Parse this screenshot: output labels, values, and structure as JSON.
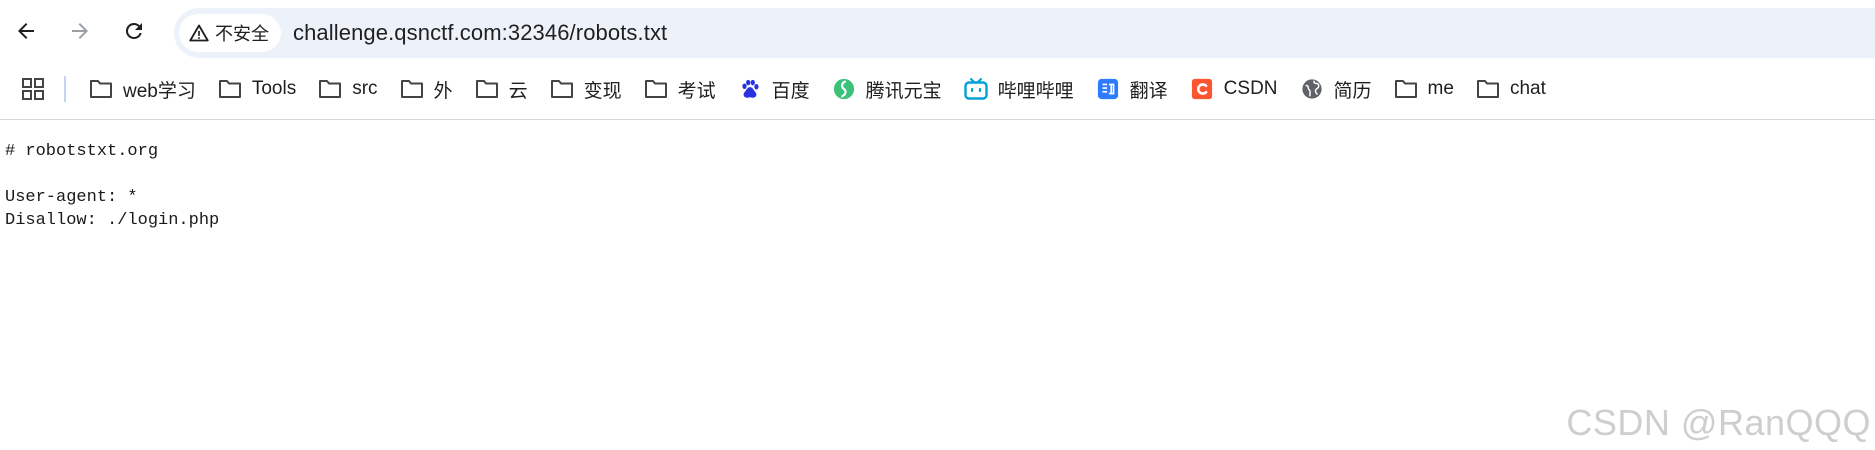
{
  "toolbar": {
    "security_label": "不安全",
    "url": "challenge.qsnctf.com:32346/robots.txt"
  },
  "bookmarks": [
    {
      "label": "web学习",
      "icon": "folder-icon"
    },
    {
      "label": "Tools",
      "icon": "folder-icon"
    },
    {
      "label": "src",
      "icon": "folder-icon"
    },
    {
      "label": "外",
      "icon": "folder-icon"
    },
    {
      "label": "云",
      "icon": "folder-icon"
    },
    {
      "label": "变现",
      "icon": "folder-icon"
    },
    {
      "label": "考试",
      "icon": "folder-icon"
    },
    {
      "label": "百度",
      "icon": "baidu-paw-icon"
    },
    {
      "label": "腾讯元宝",
      "icon": "yuanbao-icon"
    },
    {
      "label": "哔哩哔哩",
      "icon": "bilibili-tv-icon"
    },
    {
      "label": "翻译",
      "icon": "translate-icon"
    },
    {
      "label": "CSDN",
      "icon": "csdn-c-icon"
    },
    {
      "label": "简历",
      "icon": "globe-icon"
    },
    {
      "label": "me",
      "icon": "folder-icon"
    },
    {
      "label": "chat",
      "icon": "folder-icon"
    }
  ],
  "page": {
    "lines": [
      "# robotstxt.org",
      "",
      "User-agent: *",
      "Disallow: ./login.php"
    ]
  },
  "watermark": "CSDN @RanQQQ",
  "colors": {
    "omnibox_bg": "#edf2fa",
    "baidu_blue": "#2932e1",
    "yuanbao_green": "#3bc27a",
    "bilibili_blue": "#00a1d6",
    "translate_blue": "#2f7bff",
    "csdn_red": "#fc5531"
  }
}
